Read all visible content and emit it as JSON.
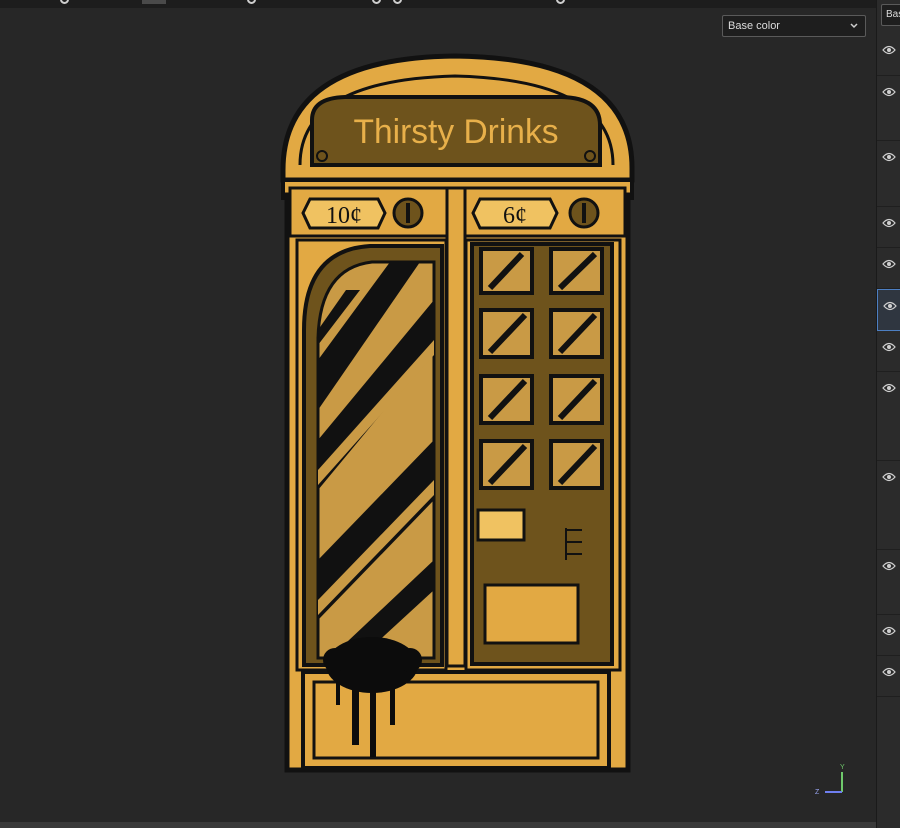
{
  "viewport": {
    "channel_dropdown": {
      "selected": "Base color",
      "icon": "chevron-down-icon"
    },
    "artwork": {
      "sign_text": "Thirsty Drinks",
      "price_left": "10¢",
      "price_right": "6¢"
    },
    "axis_gizmo": {
      "label_z": "Z",
      "label_y": "Y"
    }
  },
  "right_panel": {
    "header": "Bas",
    "layers": [
      {
        "icon": "eye-icon"
      },
      {
        "icon": "eye-icon"
      },
      {
        "icon": "eye-icon"
      },
      {
        "icon": "eye-icon"
      },
      {
        "icon": "eye-icon"
      },
      {
        "icon": "eye-icon",
        "selected": true
      },
      {
        "icon": "eye-icon"
      },
      {
        "icon": "eye-icon"
      },
      {
        "icon": "eye-icon"
      },
      {
        "icon": "eye-icon"
      },
      {
        "icon": "eye-icon"
      },
      {
        "icon": "eye-icon"
      }
    ]
  },
  "colors": {
    "accent_blue": "#4d7fc2",
    "gold": "#e8b04a",
    "ink": "#111111"
  }
}
